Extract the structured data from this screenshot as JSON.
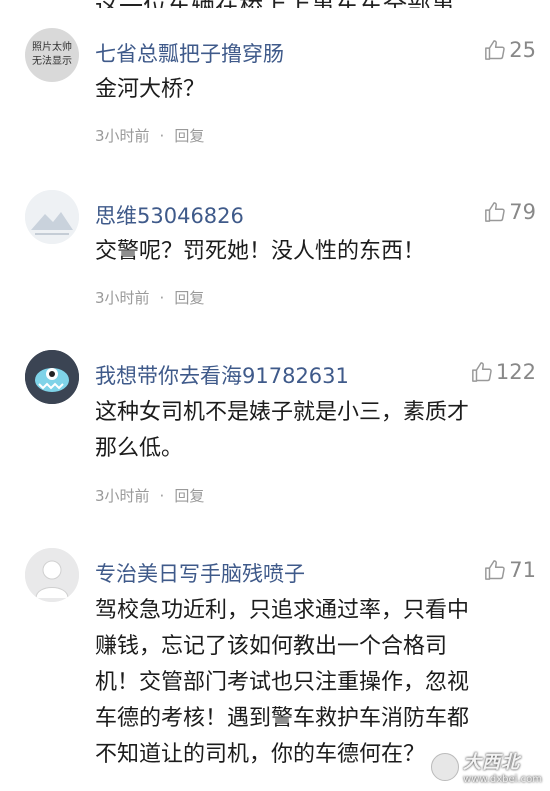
{
  "top_cut_text": "这一位车辆在桥上上事车车全部事",
  "comments": [
    {
      "avatar_text": [
        "照片太帅",
        "无法显示"
      ],
      "username": "七省总瓢把子撸穿肠",
      "likes": "25",
      "content": "金河大桥？",
      "time": "3小时前",
      "separator": "·",
      "reply": "回复"
    },
    {
      "username": "思维53046826",
      "likes": "79",
      "content": "交警呢？罚死她！没人性的东西！",
      "time": "3小时前",
      "separator": "·",
      "reply": "回复"
    },
    {
      "username": "我想带你去看海91782631",
      "likes": "122",
      "content": "这种女司机不是婊子就是小三，素质才\n那么低。",
      "time": "3小时前",
      "separator": "·",
      "reply": "回复"
    },
    {
      "username": "专治美日写手脑残喷子",
      "likes": "71",
      "content": "驾校急功近利，只追求通过率，只看中\n赚钱，忘记了该如何教出一个合格司\n机！交管部门考试也只注重操作，忽视\n车德的考核！遇到警车救护车消防车都\n不知道让的司机，你的车德何在？",
      "time": "",
      "separator": "",
      "reply": ""
    }
  ],
  "watermark": {
    "title": "大西北",
    "url": "www.dxbei.com"
  },
  "colors": {
    "username": "#3f5a8a",
    "meta": "#9a9a9a",
    "text": "#1c1c1c"
  },
  "icons": {
    "like": "thumb-up-icon"
  }
}
